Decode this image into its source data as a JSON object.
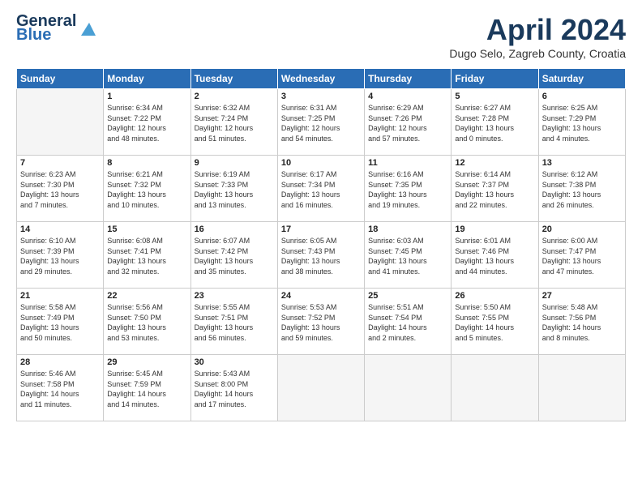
{
  "header": {
    "logo_line1": "General",
    "logo_line2": "Blue",
    "title": "April 2024",
    "subtitle": "Dugo Selo, Zagreb County, Croatia"
  },
  "weekdays": [
    "Sunday",
    "Monday",
    "Tuesday",
    "Wednesday",
    "Thursday",
    "Friday",
    "Saturday"
  ],
  "weeks": [
    [
      {
        "day": "",
        "info": ""
      },
      {
        "day": "1",
        "info": "Sunrise: 6:34 AM\nSunset: 7:22 PM\nDaylight: 12 hours\nand 48 minutes."
      },
      {
        "day": "2",
        "info": "Sunrise: 6:32 AM\nSunset: 7:24 PM\nDaylight: 12 hours\nand 51 minutes."
      },
      {
        "day": "3",
        "info": "Sunrise: 6:31 AM\nSunset: 7:25 PM\nDaylight: 12 hours\nand 54 minutes."
      },
      {
        "day": "4",
        "info": "Sunrise: 6:29 AM\nSunset: 7:26 PM\nDaylight: 12 hours\nand 57 minutes."
      },
      {
        "day": "5",
        "info": "Sunrise: 6:27 AM\nSunset: 7:28 PM\nDaylight: 13 hours\nand 0 minutes."
      },
      {
        "day": "6",
        "info": "Sunrise: 6:25 AM\nSunset: 7:29 PM\nDaylight: 13 hours\nand 4 minutes."
      }
    ],
    [
      {
        "day": "7",
        "info": "Sunrise: 6:23 AM\nSunset: 7:30 PM\nDaylight: 13 hours\nand 7 minutes."
      },
      {
        "day": "8",
        "info": "Sunrise: 6:21 AM\nSunset: 7:32 PM\nDaylight: 13 hours\nand 10 minutes."
      },
      {
        "day": "9",
        "info": "Sunrise: 6:19 AM\nSunset: 7:33 PM\nDaylight: 13 hours\nand 13 minutes."
      },
      {
        "day": "10",
        "info": "Sunrise: 6:17 AM\nSunset: 7:34 PM\nDaylight: 13 hours\nand 16 minutes."
      },
      {
        "day": "11",
        "info": "Sunrise: 6:16 AM\nSunset: 7:35 PM\nDaylight: 13 hours\nand 19 minutes."
      },
      {
        "day": "12",
        "info": "Sunrise: 6:14 AM\nSunset: 7:37 PM\nDaylight: 13 hours\nand 22 minutes."
      },
      {
        "day": "13",
        "info": "Sunrise: 6:12 AM\nSunset: 7:38 PM\nDaylight: 13 hours\nand 26 minutes."
      }
    ],
    [
      {
        "day": "14",
        "info": "Sunrise: 6:10 AM\nSunset: 7:39 PM\nDaylight: 13 hours\nand 29 minutes."
      },
      {
        "day": "15",
        "info": "Sunrise: 6:08 AM\nSunset: 7:41 PM\nDaylight: 13 hours\nand 32 minutes."
      },
      {
        "day": "16",
        "info": "Sunrise: 6:07 AM\nSunset: 7:42 PM\nDaylight: 13 hours\nand 35 minutes."
      },
      {
        "day": "17",
        "info": "Sunrise: 6:05 AM\nSunset: 7:43 PM\nDaylight: 13 hours\nand 38 minutes."
      },
      {
        "day": "18",
        "info": "Sunrise: 6:03 AM\nSunset: 7:45 PM\nDaylight: 13 hours\nand 41 minutes."
      },
      {
        "day": "19",
        "info": "Sunrise: 6:01 AM\nSunset: 7:46 PM\nDaylight: 13 hours\nand 44 minutes."
      },
      {
        "day": "20",
        "info": "Sunrise: 6:00 AM\nSunset: 7:47 PM\nDaylight: 13 hours\nand 47 minutes."
      }
    ],
    [
      {
        "day": "21",
        "info": "Sunrise: 5:58 AM\nSunset: 7:49 PM\nDaylight: 13 hours\nand 50 minutes."
      },
      {
        "day": "22",
        "info": "Sunrise: 5:56 AM\nSunset: 7:50 PM\nDaylight: 13 hours\nand 53 minutes."
      },
      {
        "day": "23",
        "info": "Sunrise: 5:55 AM\nSunset: 7:51 PM\nDaylight: 13 hours\nand 56 minutes."
      },
      {
        "day": "24",
        "info": "Sunrise: 5:53 AM\nSunset: 7:52 PM\nDaylight: 13 hours\nand 59 minutes."
      },
      {
        "day": "25",
        "info": "Sunrise: 5:51 AM\nSunset: 7:54 PM\nDaylight: 14 hours\nand 2 minutes."
      },
      {
        "day": "26",
        "info": "Sunrise: 5:50 AM\nSunset: 7:55 PM\nDaylight: 14 hours\nand 5 minutes."
      },
      {
        "day": "27",
        "info": "Sunrise: 5:48 AM\nSunset: 7:56 PM\nDaylight: 14 hours\nand 8 minutes."
      }
    ],
    [
      {
        "day": "28",
        "info": "Sunrise: 5:46 AM\nSunset: 7:58 PM\nDaylight: 14 hours\nand 11 minutes."
      },
      {
        "day": "29",
        "info": "Sunrise: 5:45 AM\nSunset: 7:59 PM\nDaylight: 14 hours\nand 14 minutes."
      },
      {
        "day": "30",
        "info": "Sunrise: 5:43 AM\nSunset: 8:00 PM\nDaylight: 14 hours\nand 17 minutes."
      },
      {
        "day": "",
        "info": ""
      },
      {
        "day": "",
        "info": ""
      },
      {
        "day": "",
        "info": ""
      },
      {
        "day": "",
        "info": ""
      }
    ]
  ]
}
